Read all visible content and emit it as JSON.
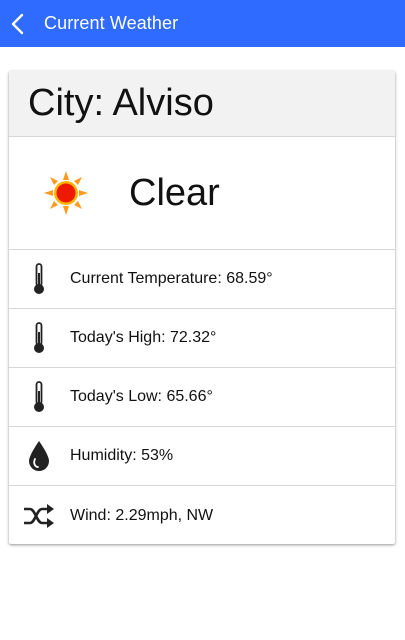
{
  "appbar": {
    "title": "Current Weather",
    "color": "#2f6bff"
  },
  "weather": {
    "city": "City: Alviso",
    "condition": "Clear",
    "condition_icon": "sun-icon",
    "rows": [
      {
        "icon": "thermometer-icon",
        "label": "Current Temperature: 68.59°"
      },
      {
        "icon": "thermometer-icon",
        "label": "Today's High: 72.32°"
      },
      {
        "icon": "thermometer-icon",
        "label": "Today's Low: 65.66°"
      },
      {
        "icon": "water-drop-icon",
        "label": "Humidity: 53%"
      },
      {
        "icon": "shuffle-icon",
        "label": "Wind: 2.29mph, NW"
      }
    ]
  }
}
